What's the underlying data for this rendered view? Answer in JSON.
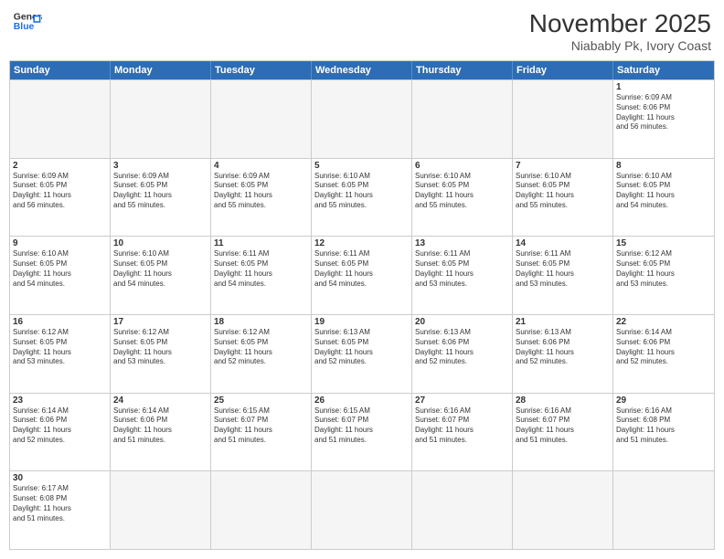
{
  "header": {
    "logo_line1": "General",
    "logo_line2": "Blue",
    "month": "November 2025",
    "location": "Niabably Pk, Ivory Coast"
  },
  "weekdays": [
    "Sunday",
    "Monday",
    "Tuesday",
    "Wednesday",
    "Thursday",
    "Friday",
    "Saturday"
  ],
  "rows": [
    [
      {
        "day": "",
        "text": ""
      },
      {
        "day": "",
        "text": ""
      },
      {
        "day": "",
        "text": ""
      },
      {
        "day": "",
        "text": ""
      },
      {
        "day": "",
        "text": ""
      },
      {
        "day": "",
        "text": ""
      },
      {
        "day": "1",
        "text": "Sunrise: 6:09 AM\nSunset: 6:06 PM\nDaylight: 11 hours\nand 56 minutes."
      }
    ],
    [
      {
        "day": "2",
        "text": "Sunrise: 6:09 AM\nSunset: 6:05 PM\nDaylight: 11 hours\nand 56 minutes."
      },
      {
        "day": "3",
        "text": "Sunrise: 6:09 AM\nSunset: 6:05 PM\nDaylight: 11 hours\nand 55 minutes."
      },
      {
        "day": "4",
        "text": "Sunrise: 6:09 AM\nSunset: 6:05 PM\nDaylight: 11 hours\nand 55 minutes."
      },
      {
        "day": "5",
        "text": "Sunrise: 6:10 AM\nSunset: 6:05 PM\nDaylight: 11 hours\nand 55 minutes."
      },
      {
        "day": "6",
        "text": "Sunrise: 6:10 AM\nSunset: 6:05 PM\nDaylight: 11 hours\nand 55 minutes."
      },
      {
        "day": "7",
        "text": "Sunrise: 6:10 AM\nSunset: 6:05 PM\nDaylight: 11 hours\nand 55 minutes."
      },
      {
        "day": "8",
        "text": "Sunrise: 6:10 AM\nSunset: 6:05 PM\nDaylight: 11 hours\nand 54 minutes."
      }
    ],
    [
      {
        "day": "9",
        "text": "Sunrise: 6:10 AM\nSunset: 6:05 PM\nDaylight: 11 hours\nand 54 minutes."
      },
      {
        "day": "10",
        "text": "Sunrise: 6:10 AM\nSunset: 6:05 PM\nDaylight: 11 hours\nand 54 minutes."
      },
      {
        "day": "11",
        "text": "Sunrise: 6:11 AM\nSunset: 6:05 PM\nDaylight: 11 hours\nand 54 minutes."
      },
      {
        "day": "12",
        "text": "Sunrise: 6:11 AM\nSunset: 6:05 PM\nDaylight: 11 hours\nand 54 minutes."
      },
      {
        "day": "13",
        "text": "Sunrise: 6:11 AM\nSunset: 6:05 PM\nDaylight: 11 hours\nand 53 minutes."
      },
      {
        "day": "14",
        "text": "Sunrise: 6:11 AM\nSunset: 6:05 PM\nDaylight: 11 hours\nand 53 minutes."
      },
      {
        "day": "15",
        "text": "Sunrise: 6:12 AM\nSunset: 6:05 PM\nDaylight: 11 hours\nand 53 minutes."
      }
    ],
    [
      {
        "day": "16",
        "text": "Sunrise: 6:12 AM\nSunset: 6:05 PM\nDaylight: 11 hours\nand 53 minutes."
      },
      {
        "day": "17",
        "text": "Sunrise: 6:12 AM\nSunset: 6:05 PM\nDaylight: 11 hours\nand 53 minutes."
      },
      {
        "day": "18",
        "text": "Sunrise: 6:12 AM\nSunset: 6:05 PM\nDaylight: 11 hours\nand 52 minutes."
      },
      {
        "day": "19",
        "text": "Sunrise: 6:13 AM\nSunset: 6:05 PM\nDaylight: 11 hours\nand 52 minutes."
      },
      {
        "day": "20",
        "text": "Sunrise: 6:13 AM\nSunset: 6:06 PM\nDaylight: 11 hours\nand 52 minutes."
      },
      {
        "day": "21",
        "text": "Sunrise: 6:13 AM\nSunset: 6:06 PM\nDaylight: 11 hours\nand 52 minutes."
      },
      {
        "day": "22",
        "text": "Sunrise: 6:14 AM\nSunset: 6:06 PM\nDaylight: 11 hours\nand 52 minutes."
      }
    ],
    [
      {
        "day": "23",
        "text": "Sunrise: 6:14 AM\nSunset: 6:06 PM\nDaylight: 11 hours\nand 52 minutes."
      },
      {
        "day": "24",
        "text": "Sunrise: 6:14 AM\nSunset: 6:06 PM\nDaylight: 11 hours\nand 51 minutes."
      },
      {
        "day": "25",
        "text": "Sunrise: 6:15 AM\nSunset: 6:07 PM\nDaylight: 11 hours\nand 51 minutes."
      },
      {
        "day": "26",
        "text": "Sunrise: 6:15 AM\nSunset: 6:07 PM\nDaylight: 11 hours\nand 51 minutes."
      },
      {
        "day": "27",
        "text": "Sunrise: 6:16 AM\nSunset: 6:07 PM\nDaylight: 11 hours\nand 51 minutes."
      },
      {
        "day": "28",
        "text": "Sunrise: 6:16 AM\nSunset: 6:07 PM\nDaylight: 11 hours\nand 51 minutes."
      },
      {
        "day": "29",
        "text": "Sunrise: 6:16 AM\nSunset: 6:08 PM\nDaylight: 11 hours\nand 51 minutes."
      }
    ],
    [
      {
        "day": "30",
        "text": "Sunrise: 6:17 AM\nSunset: 6:08 PM\nDaylight: 11 hours\nand 51 minutes."
      },
      {
        "day": "",
        "text": ""
      },
      {
        "day": "",
        "text": ""
      },
      {
        "day": "",
        "text": ""
      },
      {
        "day": "",
        "text": ""
      },
      {
        "day": "",
        "text": ""
      },
      {
        "day": "",
        "text": ""
      }
    ]
  ]
}
